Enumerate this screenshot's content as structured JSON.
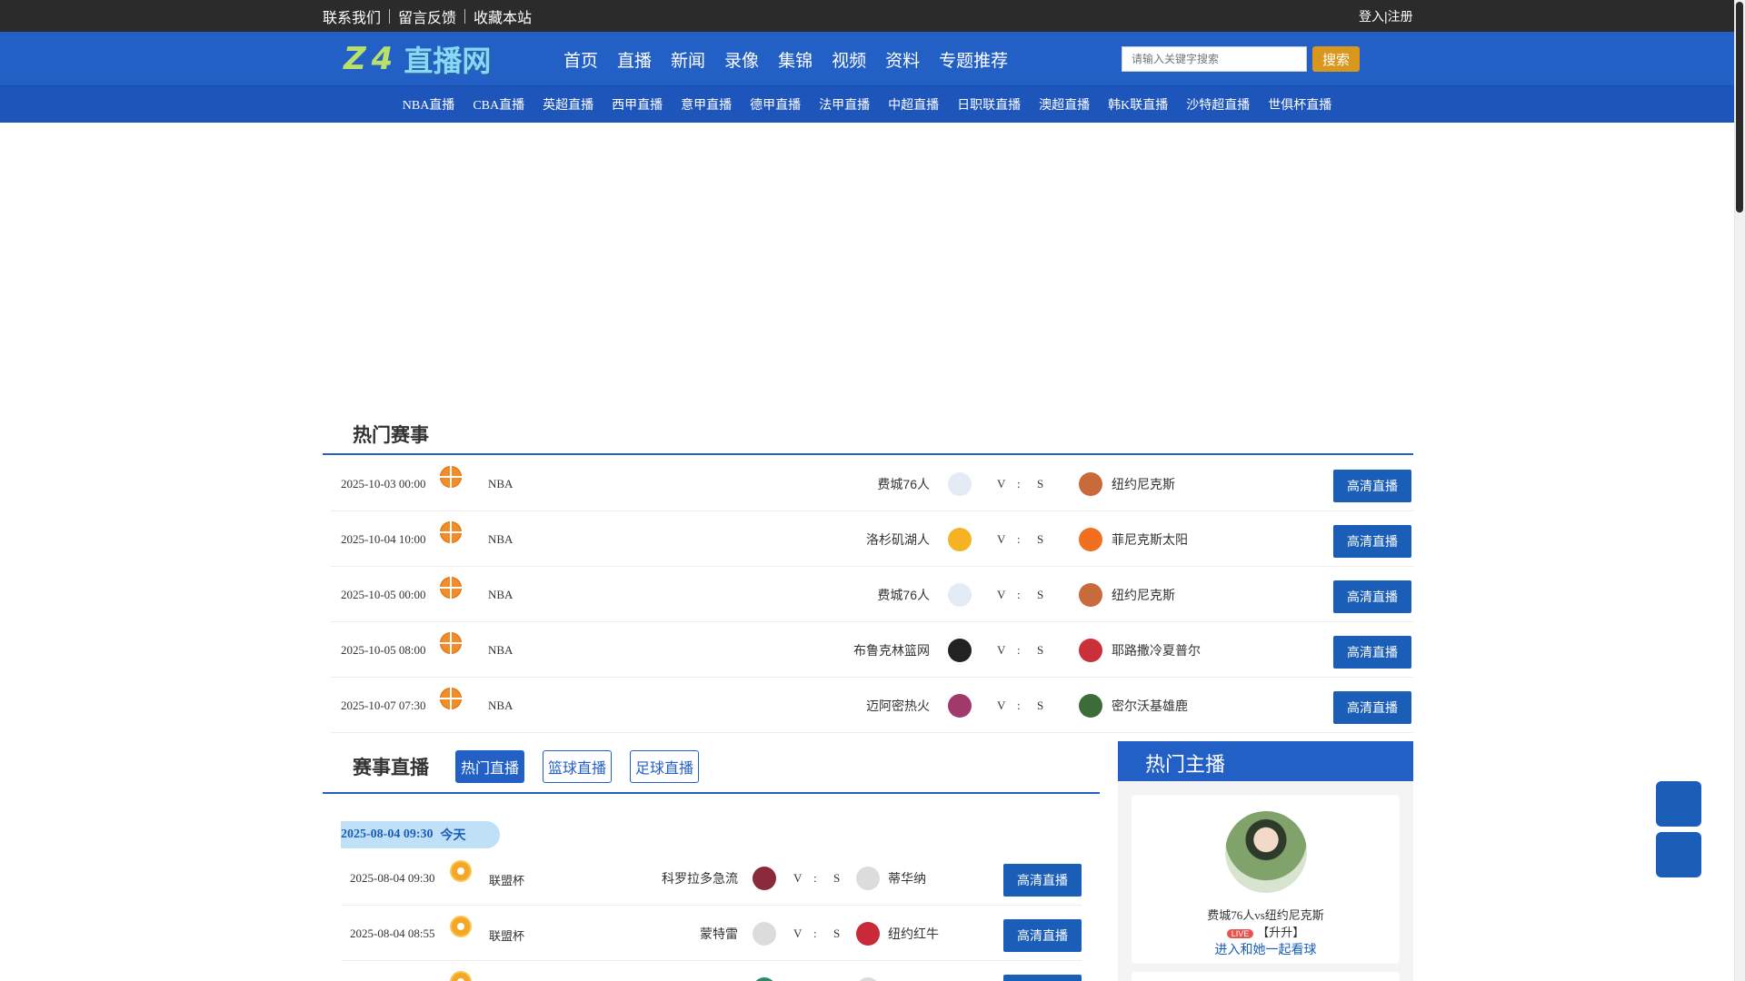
{
  "topbar": {
    "links": [
      "联系我们",
      "留言反馈",
      "收藏本站"
    ],
    "login": "登入|注册"
  },
  "header": {
    "logo_prefix": "Z4",
    "logo_text": "直播网",
    "nav": [
      "首页",
      "直播",
      "新闻",
      "录像",
      "集锦",
      "视频",
      "资料",
      "专题推荐"
    ],
    "search_placeholder": "请输入关键字搜索",
    "search_button": "搜索"
  },
  "subnav": [
    "NBA直播",
    "CBA直播",
    "英超直播",
    "西甲直播",
    "意甲直播",
    "德甲直播",
    "法甲直播",
    "中超直播",
    "日职联直播",
    "澳超直播",
    "韩K联直播",
    "沙特超直播",
    "世俱杯直播"
  ],
  "hot": {
    "title": "热门赛事",
    "matches": [
      {
        "time": "2025-10-03 00:00",
        "league": "NBA",
        "home": "费城76人",
        "away": "纽约尼克斯",
        "v": "V",
        "colon": ":",
        "s": "S",
        "button": "高清直播",
        "home_color": "#e4eaf6",
        "away_color": "#c86a3a"
      },
      {
        "time": "2025-10-04 10:00",
        "league": "NBA",
        "home": "洛杉矶湖人",
        "away": "菲尼克斯太阳",
        "v": "V",
        "colon": ":",
        "s": "S",
        "button": "高清直播",
        "home_color": "#f5b324",
        "away_color": "#f07020"
      },
      {
        "time": "2025-10-05 00:00",
        "league": "NBA",
        "home": "费城76人",
        "away": "纽约尼克斯",
        "v": "V",
        "colon": ":",
        "s": "S",
        "button": "高清直播",
        "home_color": "#e4eaf6",
        "away_color": "#c86a3a"
      },
      {
        "time": "2025-10-05 08:00",
        "league": "NBA",
        "home": "布鲁克林篮网",
        "away": "耶路撒冷夏普尔",
        "v": "V",
        "colon": ":",
        "s": "S",
        "button": "高清直播",
        "home_color": "#222222",
        "away_color": "#c9303a"
      },
      {
        "time": "2025-10-07 07:30",
        "league": "NBA",
        "home": "迈阿密热火",
        "away": "密尔沃基雄鹿",
        "v": "V",
        "colon": ":",
        "s": "S",
        "button": "高清直播",
        "home_color": "#a13a6a",
        "away_color": "#3e6b3a"
      }
    ]
  },
  "live": {
    "title": "赛事直播",
    "tabs": [
      "热门直播",
      "篮球直播",
      "足球直播"
    ],
    "date_label": "2025-08-04 09:30",
    "date_today": "今天",
    "matches": [
      {
        "time": "2025-08-04 09:30",
        "league": "联盟杯",
        "home": "科罗拉多急流",
        "away": "蒂华纳",
        "v": "V",
        "colon": ":",
        "s": "S",
        "button": "高清直播",
        "home_color": "#8b2a3a",
        "away_color": "#dcdcdc"
      },
      {
        "time": "2025-08-04 08:55",
        "league": "联盟杯",
        "home": "蒙特雷",
        "away": "纽约红牛",
        "v": "V",
        "colon": ":",
        "s": "S",
        "button": "高清直播",
        "home_color": "#dcdcdc",
        "away_color": "#c92a3a"
      },
      {
        "time": "",
        "league": "",
        "home": "",
        "away": "",
        "v": "",
        "colon": "",
        "s": "",
        "button": "",
        "home_color": "#2a8a6a",
        "away_color": "#dcdcdc"
      }
    ]
  },
  "anchor": {
    "title": "热门主播",
    "match": "费城76人vs纽约尼克斯",
    "live_badge": "LIVE",
    "tag": "【升升】",
    "link": "进入和她一起看球"
  }
}
